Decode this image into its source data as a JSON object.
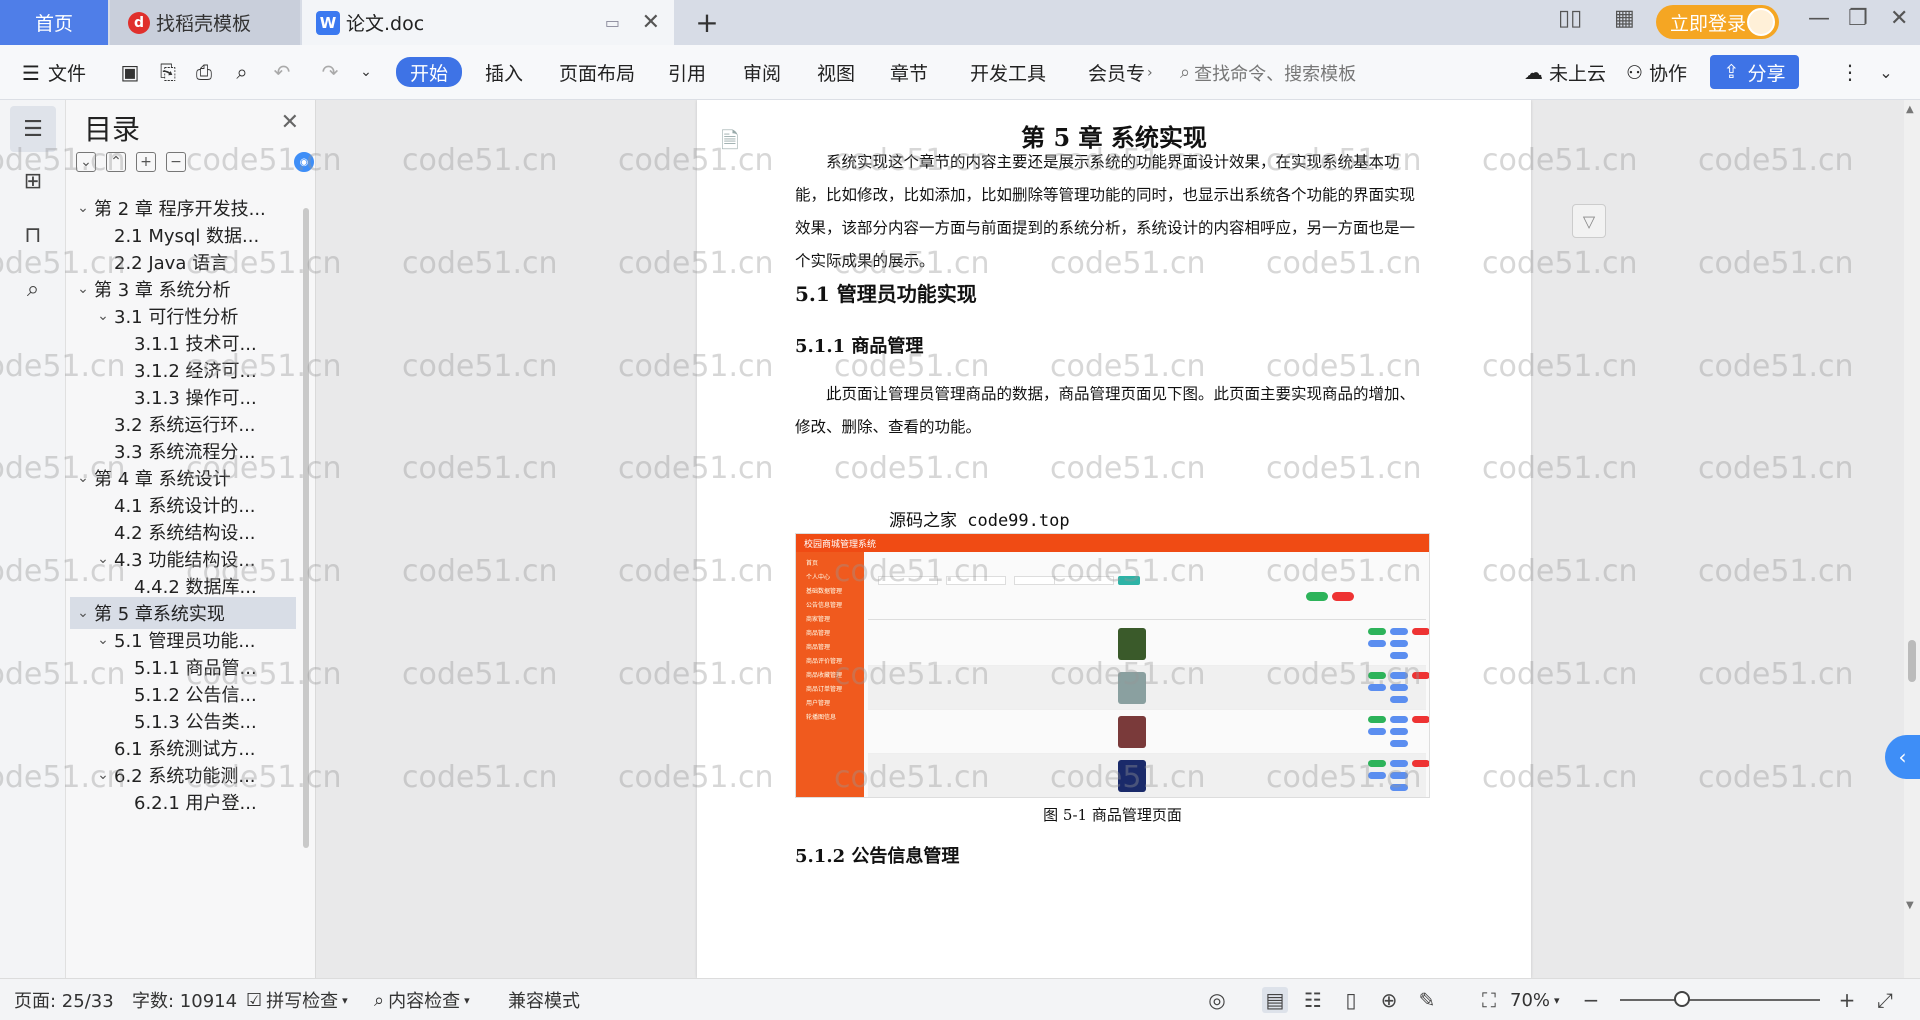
{
  "tabs": {
    "home": "首页",
    "daoke": "找稻壳模板",
    "doc": "论文.doc"
  },
  "titlebar": {
    "login": "立即登录"
  },
  "menu": {
    "file": "文件",
    "start": "开始",
    "insert": "插入",
    "layout": "页面布局",
    "reference": "引用",
    "review": "审阅",
    "view": "视图",
    "chapter": "章节",
    "devtools": "开发工具",
    "member": "会员专",
    "search_placeholder": "查找命令、搜索模板",
    "cloud": "未上云",
    "collab": "协作",
    "share": "分享"
  },
  "toc": {
    "title": "目录",
    "items": [
      {
        "label": "第 2 章  程序开发技...",
        "level": 1,
        "chev": "v"
      },
      {
        "label": "2.1 Mysql 数据...",
        "level": 2,
        "chev": ""
      },
      {
        "label": "2.2 Java 语言",
        "level": 2,
        "chev": ""
      },
      {
        "label": "第 3 章  系统分析",
        "level": 1,
        "chev": "v"
      },
      {
        "label": "3.1 可行性分析",
        "level": 2,
        "chev": "v"
      },
      {
        "label": "3.1.1 技术可...",
        "level": 3,
        "chev": ""
      },
      {
        "label": "3.1.2 经济可...",
        "level": 3,
        "chev": ""
      },
      {
        "label": "3.1.3 操作可...",
        "level": 3,
        "chev": ""
      },
      {
        "label": "3.2 系统运行环...",
        "level": 2,
        "chev": ""
      },
      {
        "label": "3.3 系统流程分...",
        "level": 2,
        "chev": ""
      },
      {
        "label": "第 4 章  系统设计",
        "level": 1,
        "chev": "v"
      },
      {
        "label": "4.1  系统设计的...",
        "level": 2,
        "chev": ""
      },
      {
        "label": "4.2  系统结构设...",
        "level": 2,
        "chev": ""
      },
      {
        "label": "4.3 功能结构设...",
        "level": 2,
        "chev": "v"
      },
      {
        "label": "4.4.2  数据库...",
        "level": 3,
        "chev": ""
      },
      {
        "label": "第 5 章系统实现",
        "level": 1,
        "chev": "v",
        "selected": true
      },
      {
        "label": "5.1 管理员功能...",
        "level": 2,
        "chev": "v"
      },
      {
        "label": "5.1.1  商品管...",
        "level": 3,
        "chev": ""
      },
      {
        "label": "5.1.2  公告信...",
        "level": 3,
        "chev": ""
      },
      {
        "label": "5.1.3 公告类...",
        "level": 3,
        "chev": ""
      },
      {
        "label": "6.1 系统测试方...",
        "level": 2,
        "chev": ""
      },
      {
        "label": "6.2  系统功能测...",
        "level": 2,
        "chev": "v"
      },
      {
        "label": "6.2.1  用户登...",
        "level": 3,
        "chev": ""
      }
    ]
  },
  "document": {
    "chapter_title": "第 5 章  系统实现",
    "intro": "系统实现这个章节的内容主要还是展示系统的功能界面设计效果，在实现系统基本功能，比如修改，比如添加，比如删除等管理功能的同时，也显示出系统各个功能的界面实现效果，该部分内容一方面与前面提到的系统分析，系统设计的内容相呼应，另一方面也是一个实际成果的展示。",
    "section_5_1": "5.1 管理员功能实现",
    "section_5_1_1": "5.1.1  商品管理",
    "para_5_1_1": "此页面让管理员管理商品的数据，商品管理页面见下图。此页面主要实现商品的增加、修改、删除、查看的功能。",
    "source_tag": "源码之家 code99.top",
    "figure_header": "校园商城管理系统",
    "figure_caption": "图 5-1  商品管理页面",
    "section_5_1_2": "5.1.2  公告信息管理"
  },
  "figure_sidebar": [
    "首页",
    "个人中心",
    "基础数据管理",
    "公告信息管理",
    "商家管理",
    "商品管理",
    "商品管理",
    "商品评价管理",
    "商品收藏管理",
    "商品订单管理",
    "用户管理",
    "轮播图信息"
  ],
  "watermark": "code51.cn",
  "status": {
    "page": "页面: 25/33",
    "words": "字数: 10914",
    "spell": "拼写检查",
    "content": "内容检查",
    "compat": "兼容模式",
    "zoom": "70%"
  },
  "colors": {
    "accent": "#3e73e6",
    "login": "#f5a623",
    "figure_orange": "#f04b14"
  }
}
